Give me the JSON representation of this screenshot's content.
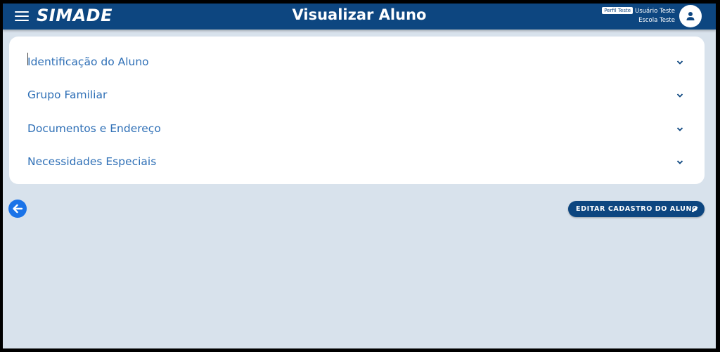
{
  "header": {
    "logo": "SIMADE",
    "title": "Visualizar Aluno",
    "profile_badge": "Perfil Teste",
    "user_name": "Usuário Teste",
    "school_name": "Escola Teste"
  },
  "accordion": {
    "items": [
      {
        "label": "Identificação do Aluno"
      },
      {
        "label": "Grupo Familiar"
      },
      {
        "label": "Documentos e Endereço"
      },
      {
        "label": "Necessidades Especiais"
      }
    ]
  },
  "actions": {
    "edit_label": "EDITAR CADASTRO DO ALUNO"
  },
  "icons": {
    "menu": "hamburger-icon",
    "avatar": "person-icon",
    "chevron": "chevron-down-icon",
    "back": "arrow-left-icon",
    "edit": "pencil-icon"
  },
  "colors": {
    "header_bg": "#0d4680",
    "page_bg": "#d8e2ec",
    "accordion_text": "#2e6fb6",
    "back_button": "#1a73e8"
  }
}
